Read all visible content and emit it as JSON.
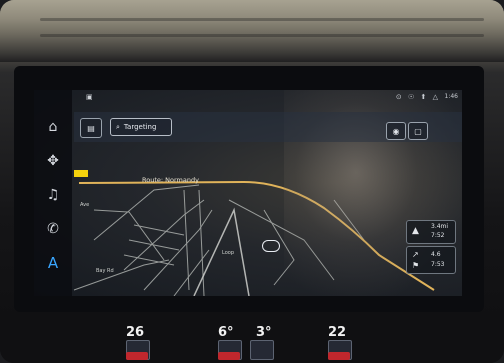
{
  "nav": {
    "search_label": "Targeting",
    "road_label": "Route: Normandy",
    "small_roads": [
      "Ave",
      "Bay Rd",
      "Loop"
    ],
    "time": "1:46",
    "status_icons": "⊙ ☉ ⬆ △"
  },
  "panels": {
    "top": {
      "line1": "3.4mi",
      "line2": "7:52"
    },
    "bottom": {
      "line1": "4.6",
      "line2": "7:53"
    }
  },
  "climate": {
    "left_temp": "26",
    "mid_left": "6°",
    "mid_right": "3°",
    "right_temp": "22"
  },
  "colors": {
    "route": "#e0b35a",
    "accent": "#3aa6ff",
    "flag": "#f5d20d"
  }
}
